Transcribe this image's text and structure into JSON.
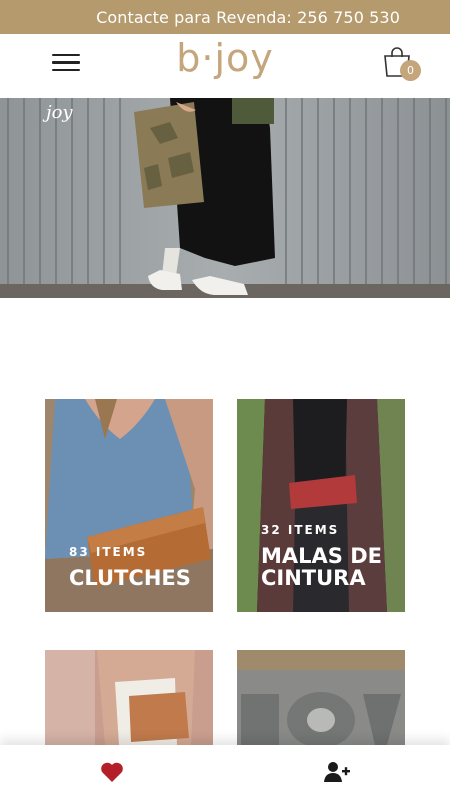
{
  "topbar": {
    "text": "Contacte para Revenda: 256 750 530"
  },
  "header": {
    "logo": "b·joy",
    "cart_count": "0"
  },
  "hero": {
    "brand_text": "joy"
  },
  "categories": [
    {
      "count": "83 ITEMS",
      "title_line1": "CLUTCHES",
      "title_line2": ""
    },
    {
      "count": "32 ITEMS",
      "title_line1": "MALAS DE",
      "title_line2": "CINTURA"
    }
  ],
  "colors": {
    "accent": "#b49a6c",
    "logo": "#c4a57c",
    "heart": "#b3202a"
  },
  "icons": {
    "menu": "hamburger-menu-icon",
    "cart": "shopping-bag-icon",
    "favorites": "heart-icon",
    "account": "add-user-icon"
  }
}
